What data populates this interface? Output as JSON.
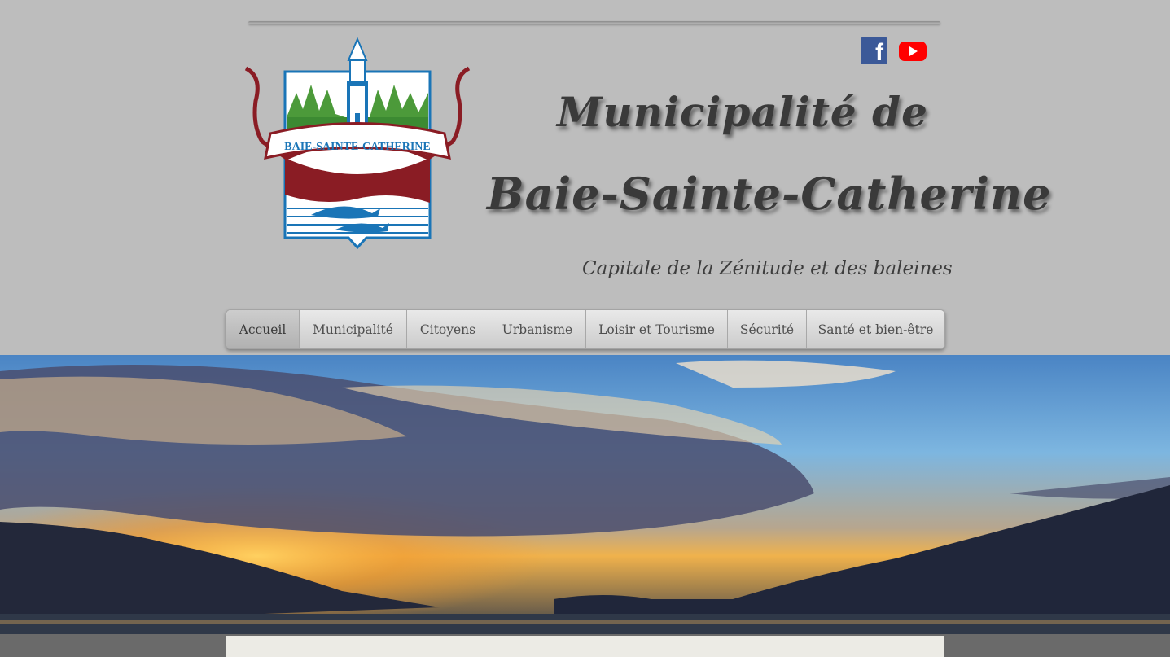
{
  "header": {
    "title_line1": "Municipalité de",
    "title_line2": "Baie-Sainte-Catherine",
    "tagline": "Capitale de la Zénitude et des baleines"
  },
  "crest": {
    "ribbon_text": "BAIE-SAINTE-CATHERINE",
    "colors": {
      "blue": "#1a75b7",
      "red": "#8a1c24",
      "green": "#4c9a3a"
    }
  },
  "social": {
    "facebook_icon": "facebook-icon",
    "youtube_icon": "youtube-icon",
    "facebook_letter": "f"
  },
  "nav": {
    "items": [
      {
        "label": "Accueil",
        "active": true
      },
      {
        "label": "Municipalité",
        "active": false
      },
      {
        "label": "Citoyens",
        "active": false
      },
      {
        "label": "Urbanisme",
        "active": false
      },
      {
        "label": "Loisir et Tourisme",
        "active": false
      },
      {
        "label": "Sécurité",
        "active": false
      },
      {
        "label": "Santé et bien-être",
        "active": false
      }
    ]
  }
}
